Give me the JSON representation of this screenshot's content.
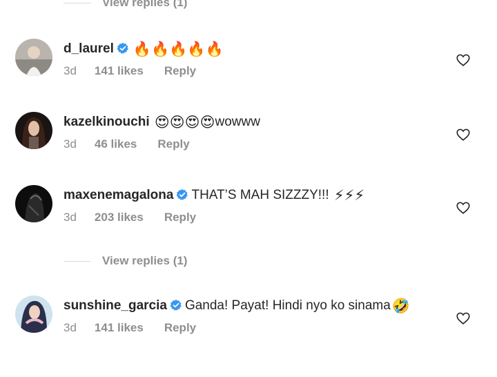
{
  "top_view_replies": "View replies (1)",
  "mid_view_replies": "View replies (1)",
  "comments": [
    {
      "username": "d_laurel",
      "verified": true,
      "text": "",
      "emoji": "🔥🔥🔥🔥🔥",
      "time": "3d",
      "likes": "141 likes",
      "reply": "Reply",
      "avatar_icon": "profile-photo"
    },
    {
      "username": "kazelkinouchi",
      "verified": false,
      "text": "wowww",
      "emoji": "😍😍😍😍",
      "time": "3d",
      "likes": "46 likes",
      "reply": "Reply",
      "avatar_icon": "profile-photo"
    },
    {
      "username": "maxenemagalona",
      "verified": true,
      "text": "THAT’S MAH SIZZZY!!!",
      "emoji": "⚡⚡⚡",
      "time": "3d",
      "likes": "203 likes",
      "reply": "Reply",
      "avatar_icon": "profile-photo"
    },
    {
      "username": "sunshine_garcia",
      "verified": true,
      "text": "Ganda! Payat! Hindi nyo ko sinama",
      "emoji": "🤣",
      "time": "3d",
      "likes": "141 likes",
      "reply": "Reply",
      "avatar_icon": "profile-photo"
    }
  ],
  "colors": {
    "text": "#262626",
    "secondary": "#8e8e8e",
    "verified_badge": "#3897f0",
    "divider": "#dbdbdb"
  }
}
